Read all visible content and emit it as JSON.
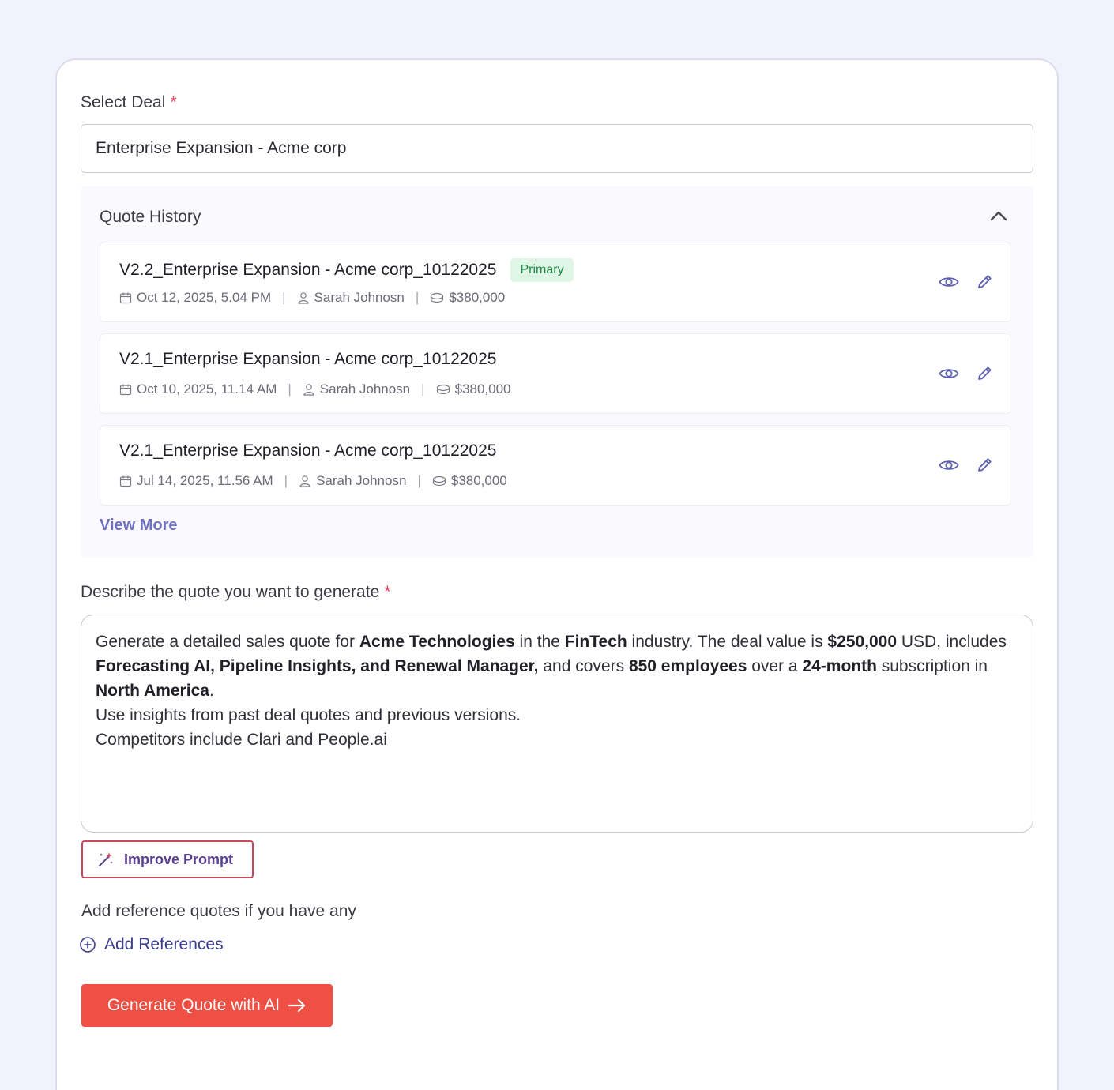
{
  "deal": {
    "label": "Select Deal",
    "required_mark": "*",
    "value": "Enterprise Expansion - Acme corp"
  },
  "history": {
    "title": "Quote History",
    "collapse_icon": "chevron-up-icon",
    "view_more": "View More",
    "items": [
      {
        "title": "V2.2_Enterprise Expansion - Acme corp_10122025",
        "badge": "Primary",
        "date": "Oct 12, 2025, 5.04 PM",
        "owner": "Sarah Johnosn",
        "amount": "$380,000"
      },
      {
        "title": "V2.1_Enterprise Expansion - Acme corp_10122025",
        "badge": "",
        "date": "Oct 10, 2025, 11.14 AM",
        "owner": "Sarah Johnosn",
        "amount": "$380,000"
      },
      {
        "title": "V2.1_Enterprise Expansion - Acme corp_10122025",
        "badge": "",
        "date": "Jul 14, 2025, 11.56 AM",
        "owner": "Sarah Johnosn",
        "amount": "$380,000"
      }
    ]
  },
  "prompt": {
    "label": "Describe the quote you want to generate",
    "required_mark": "*",
    "t1": "Generate a detailed sales quote for ",
    "b1": "Acme Technologies",
    "t2": " in the ",
    "b2": "FinTech",
    "t3": " industry. The deal value is ",
    "b3": "$250,000",
    "t4": " USD, includes ",
    "b4": "Forecasting AI, Pipeline Insights, and Renewal Manager,",
    "t5": " and covers ",
    "b5": "850 employees",
    "t6": " over a ",
    "b6": "24-month",
    "t7": " subscription in ",
    "b7": "North America",
    "t8": ".",
    "line2": "Use insights from past deal quotes and previous versions.",
    "line3": "Competitors include Clari and People.ai"
  },
  "improve_button": "Improve Prompt",
  "references": {
    "label": "Add reference quotes if you have any",
    "add": "Add References"
  },
  "generate_button": "Generate Quote with AI",
  "colors": {
    "accent_red": "#f04f43",
    "primary_badge_bg": "#dff6e6",
    "primary_badge_text": "#1e8a46",
    "link_purple": "#6f71c0",
    "icon_purple": "#5b5fae"
  }
}
